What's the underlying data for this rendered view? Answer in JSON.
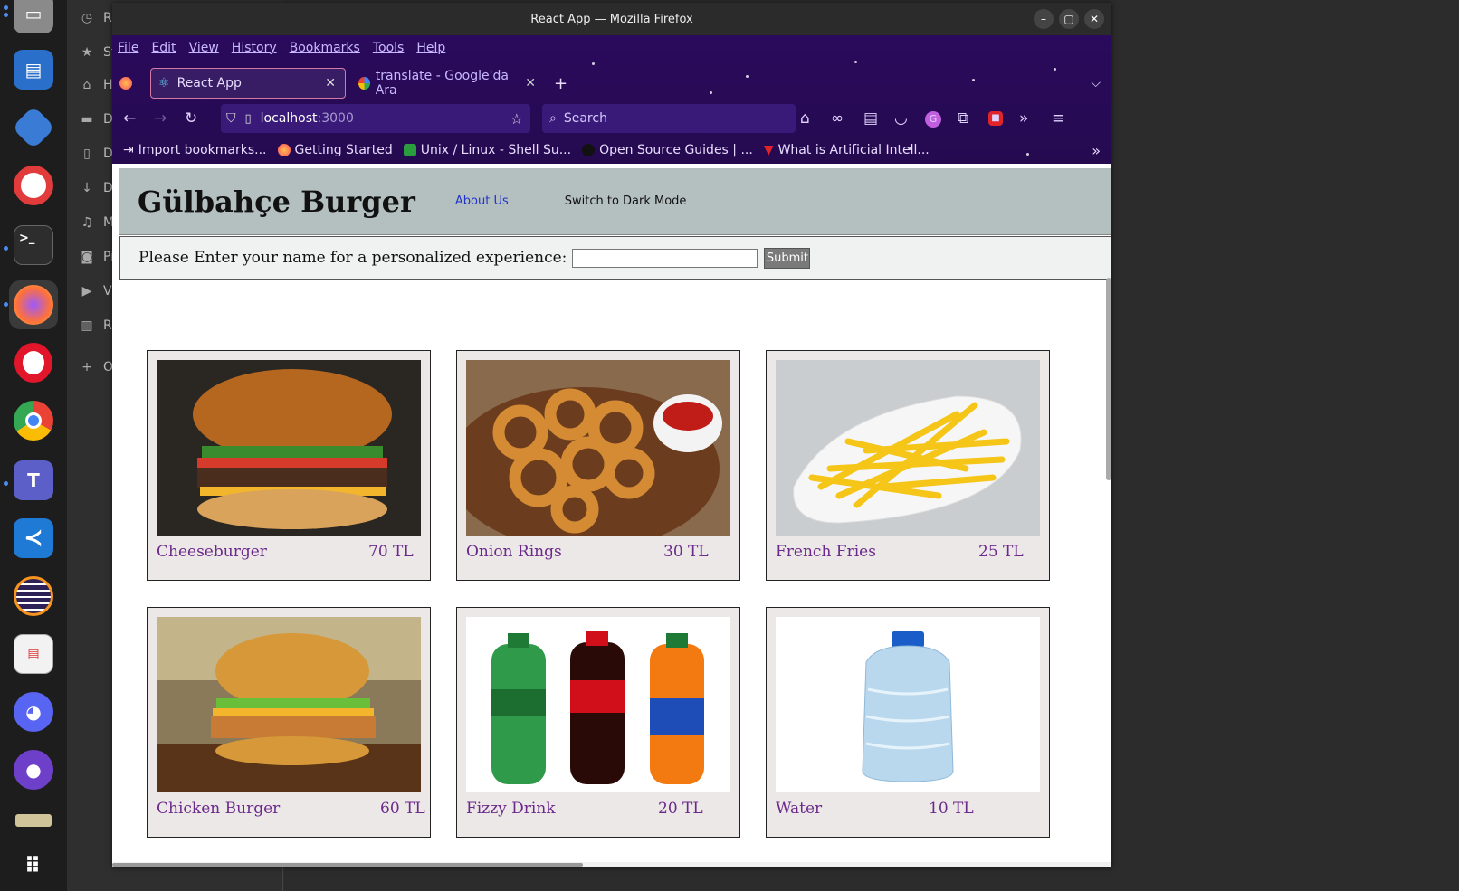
{
  "dock": {
    "apps": [
      "files-icon",
      "libreoffice-impress-icon",
      "git-cola-icon",
      "help-lifebuoy-icon",
      "terminal-icon",
      "firefox-icon",
      "opera-icon",
      "chrome-icon",
      "teams-icon",
      "vscode-icon",
      "eclipse-icon",
      "document-viewer-icon",
      "discord-icon",
      "github-desktop-icon",
      "drive-icon",
      "app-grid-icon"
    ]
  },
  "file_manager": {
    "items": [
      {
        "icon": "recent-icon",
        "label": "Re"
      },
      {
        "icon": "star-icon",
        "label": "St"
      },
      {
        "icon": "home-icon",
        "label": "H"
      },
      {
        "icon": "folder-icon",
        "label": "D"
      },
      {
        "icon": "document-icon",
        "label": "D"
      },
      {
        "icon": "download-icon",
        "label": "D"
      },
      {
        "icon": "music-icon",
        "label": "M"
      },
      {
        "icon": "camera-icon",
        "label": "Pi"
      },
      {
        "icon": "video-icon",
        "label": "V"
      },
      {
        "icon": "trash-icon",
        "label": "Re"
      },
      {
        "icon": "plus-icon",
        "label": "O"
      }
    ]
  },
  "window": {
    "title": "React App — Mozilla Firefox",
    "menu": [
      "File",
      "Edit",
      "View",
      "History",
      "Bookmarks",
      "Tools",
      "Help"
    ],
    "tabs": [
      {
        "label": "React App",
        "active": true
      },
      {
        "label": "translate - Google'da Ara",
        "active": false
      }
    ],
    "url_host": "localhost",
    "url_port": ":3000",
    "search_placeholder": "Search",
    "bookmarks": [
      "Import bookmarks...",
      "Getting Started",
      "Unix / Linux - Shell Su...",
      "Open Source Guides | ...",
      "What is Artificial Intell..."
    ]
  },
  "page": {
    "title": "Gülbahçe Burger",
    "about_label": "About Us",
    "dark_mode_label": "Switch to Dark Mode",
    "name_prompt": "Please Enter your name for a personalized experience:",
    "name_value": "",
    "submit_label": "Submit",
    "menu_items": [
      {
        "name": "Cheeseburger",
        "price": "70 TL"
      },
      {
        "name": "Onion Rings",
        "price": "30 TL"
      },
      {
        "name": "French Fries",
        "price": "25 TL"
      },
      {
        "name": "Chicken Burger",
        "price": "60 TL"
      },
      {
        "name": "Fizzy Drink",
        "price": "20 TL"
      },
      {
        "name": "Water",
        "price": "10 TL"
      }
    ]
  },
  "colors": {
    "chrome_bg": "#2a0a5c",
    "header_bg": "#b4bfbf",
    "card_bg": "#ece8e8",
    "item_text": "#6b2a8a"
  }
}
